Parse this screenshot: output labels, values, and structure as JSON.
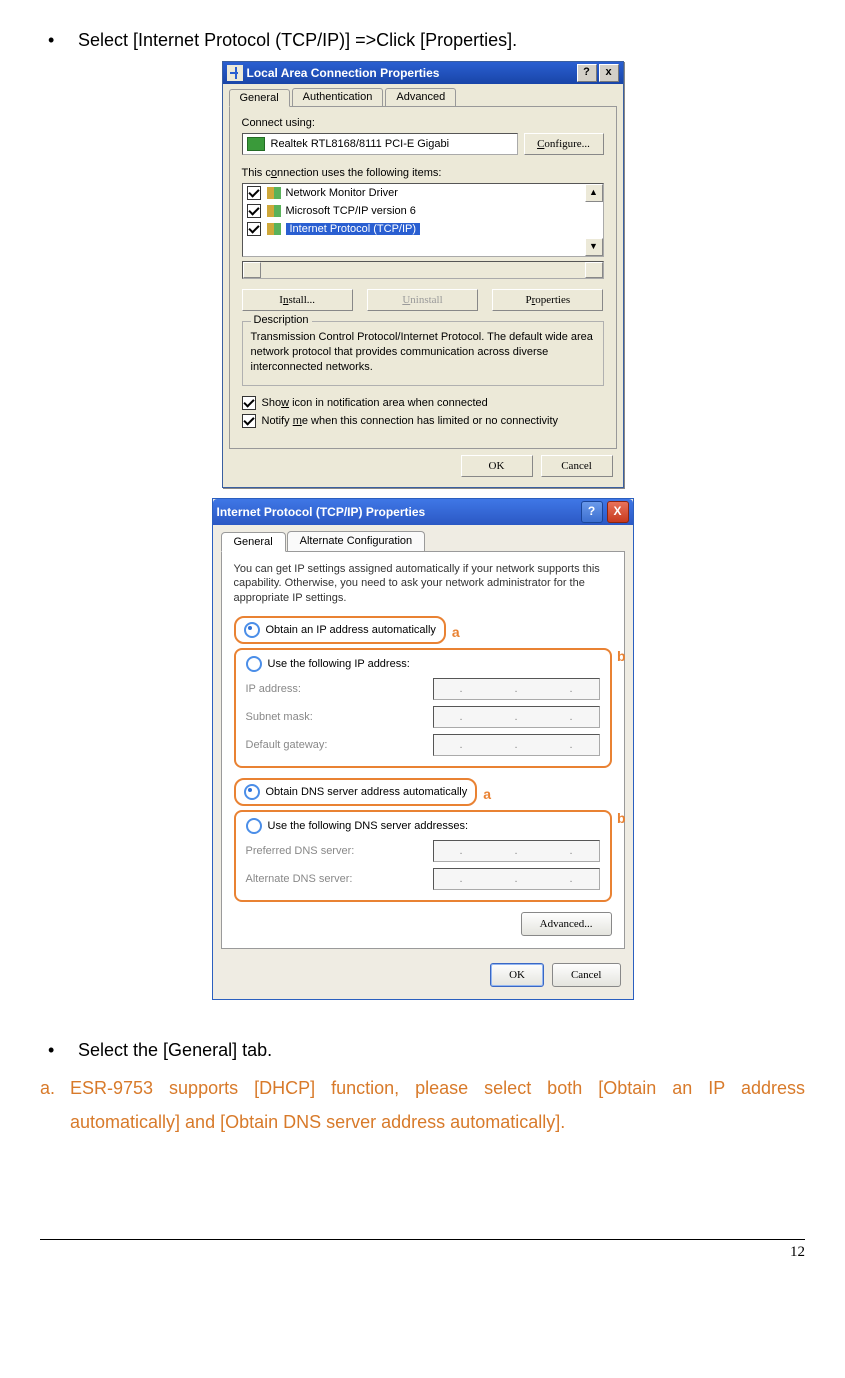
{
  "topline": "Select [Internet Protocol (TCP/IP)] =>Click [Properties].",
  "dlg1": {
    "title": "Local Area Connection Properties",
    "help": "?",
    "close": "x",
    "tabs": {
      "general": "General",
      "auth": "Authentication",
      "adv": "Advanced"
    },
    "connect_using": "Connect using:",
    "nic": "Realtek RTL8168/8111 PCI-E Gigabi",
    "configure": "Configure...",
    "items_label": "This connection uses the following items:",
    "items": {
      "nmd": "Network Monitor Driver",
      "tcp6": "Microsoft TCP/IP version 6",
      "tcpip": "Internet Protocol (TCP/IP)"
    },
    "install": "Install...",
    "uninstall": "Uninstall",
    "properties": "Properties",
    "desc_title": "Description",
    "desc": "Transmission Control Protocol/Internet Protocol. The default wide area network protocol that provides communication across diverse interconnected networks.",
    "show_icon": "Show icon in notification area when connected",
    "notify": "Notify me when this connection has limited or no connectivity",
    "ok": "OK",
    "cancel": "Cancel"
  },
  "dlg2": {
    "title": "Internet Protocol (TCP/IP) Properties",
    "tabs": {
      "general": "General",
      "alt": "Alternate Configuration"
    },
    "para": "You can get IP settings assigned automatically if your network supports this capability. Otherwise, you need to ask your network administrator for the appropriate IP settings.",
    "obtain_ip": "Obtain an IP address automatically",
    "use_ip": "Use the following IP address:",
    "ip_addr": "IP address:",
    "subnet": "Subnet mask:",
    "gateway": "Default gateway:",
    "obtain_dns": "Obtain DNS server address automatically",
    "use_dns": "Use the following DNS server addresses:",
    "pref_dns": "Preferred DNS server:",
    "alt_dns": "Alternate DNS server:",
    "advanced": "Advanced...",
    "ok": "OK",
    "cancel": "Cancel",
    "tag_a": "a",
    "tag_b": "b"
  },
  "bottom": {
    "line1": "Select the [General] tab.",
    "line2": "ESR-9753 supports [DHCP] function, please select both [Obtain an IP address automatically] and [Obtain DNS server address automatically].",
    "marker_a": "a."
  },
  "page_num": "12",
  "bullet": "•"
}
